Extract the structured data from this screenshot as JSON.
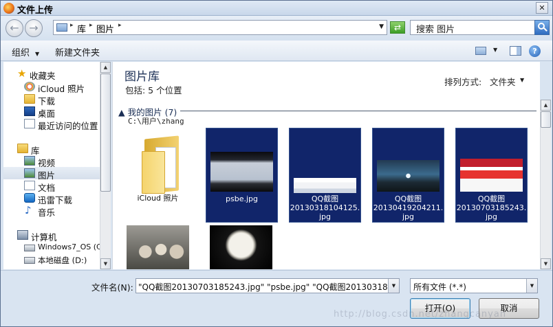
{
  "window": {
    "title": "文件上传",
    "close_glyph": "✕"
  },
  "address": {
    "breadcrumbs": [
      "库",
      "图片"
    ],
    "search_placeholder": "搜索 图片"
  },
  "toolbar": {
    "organize": "组织",
    "new_folder": "新建文件夹"
  },
  "nav": {
    "favorites": {
      "label": "收藏夹",
      "items": [
        "iCloud 照片",
        "下载",
        "桌面",
        "最近访问的位置"
      ]
    },
    "libraries": {
      "label": "库",
      "items": [
        "视频",
        "图片",
        "文档",
        "迅雷下载",
        "音乐"
      ],
      "selected": "图片"
    },
    "computer": {
      "label": "计算机",
      "items": [
        "Windows7_OS (C:",
        "本地磁盘 (D:)"
      ]
    }
  },
  "main": {
    "title": "图片库",
    "subtitle": "包括: 5 个位置",
    "sort_label": "排列方式:",
    "sort_value": "文件夹",
    "group": {
      "name": "我的图片 (7)",
      "path": "C:\\用户\\zhang"
    },
    "tiles": [
      {
        "caption": "iCloud 照片",
        "selected": false,
        "kind": "folder"
      },
      {
        "caption": "psbe.jpg",
        "selected": true,
        "kind": "screen"
      },
      {
        "caption": "QQ截图\n20130318104125.\njpg",
        "selected": true,
        "kind": "web"
      },
      {
        "caption": "QQ截图\n20130419204211.\njpg",
        "selected": true,
        "kind": "mountain"
      },
      {
        "caption": "QQ截图\n20130703185243.\njpg",
        "selected": true,
        "kind": "red-site"
      },
      {
        "caption": "",
        "selected": false,
        "kind": "owls"
      },
      {
        "caption": "",
        "selected": false,
        "kind": "moon-wolf"
      }
    ]
  },
  "footer": {
    "filename_label": "文件名(N):",
    "filename_value": "\"QQ截图20130703185243.jpg\" \"psbe.jpg\" \"QQ截图2013031810",
    "filetype_value": "所有文件 (*.*)",
    "open_label": "打开(O)",
    "cancel_label": "取消",
    "watermark": "http://blog.csdn.net/zhangcanyan"
  }
}
